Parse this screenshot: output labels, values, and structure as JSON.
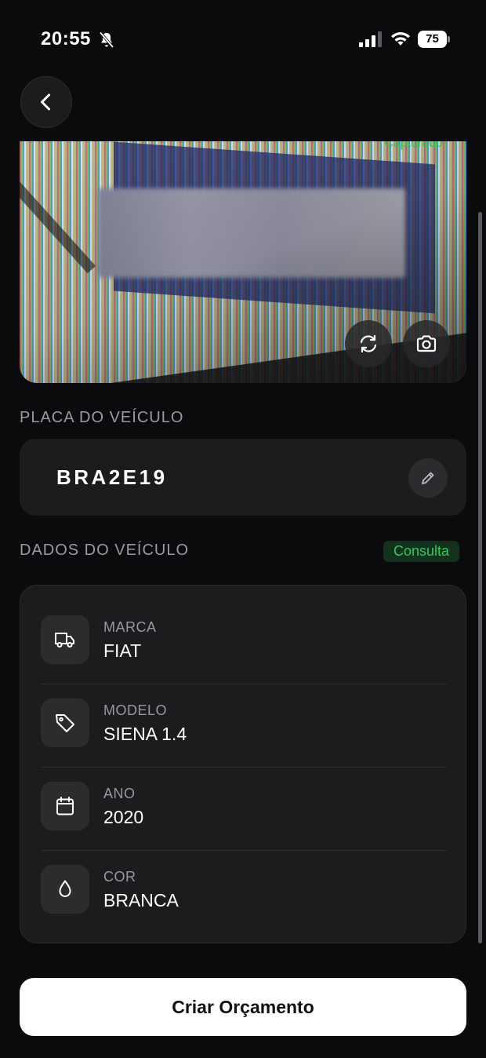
{
  "status_bar": {
    "time": "20:55",
    "battery": "75",
    "icons": [
      "bell-slash-icon",
      "signal-icon",
      "wifi-icon",
      "battery-icon"
    ]
  },
  "header": {
    "back_icon": "chevron-left-icon"
  },
  "photo": {
    "capture_label": "Capturado",
    "refresh_icon": "refresh-icon",
    "camera_icon": "camera-icon"
  },
  "plate": {
    "section_label": "PLACA DO VEÍCULO",
    "value": "BRA2E19",
    "edit_icon": "pencil-icon"
  },
  "vehicle": {
    "section_label": "DADOS DO VEÍCULO",
    "badge": "Consulta",
    "rows": [
      {
        "label": "MARCA",
        "value": "FIAT",
        "icon": "truck-icon"
      },
      {
        "label": "MODELO",
        "value": "SIENA 1.4",
        "icon": "tag-icon"
      },
      {
        "label": "ANO",
        "value": "2020",
        "icon": "calendar-icon"
      },
      {
        "label": "COR",
        "value": "BRANCA",
        "icon": "droplet-icon"
      }
    ]
  },
  "actions": {
    "primary_label": "Criar Orçamento"
  },
  "colors": {
    "background": "#0b0b0d",
    "card": "#1c1c1e",
    "accent_green": "#34c759",
    "button": "#ffffff"
  }
}
